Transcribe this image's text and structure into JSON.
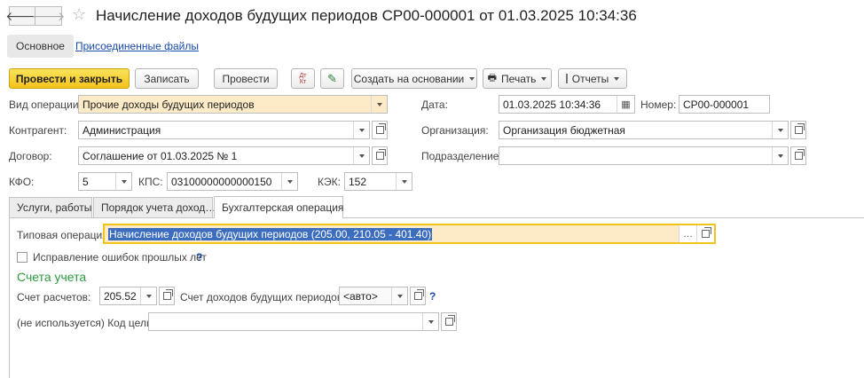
{
  "header": {
    "title": "Начисление доходов будущих периодов СР00-000001 от 01.03.2025 10:34:36",
    "back_icon": "arrow-left-icon",
    "forward_icon": "arrow-right-icon",
    "favorite_icon": "star-icon"
  },
  "top_tabs": {
    "main": "Основное",
    "attached": "Присоединенные файлы"
  },
  "toolbar": {
    "post_close": "Провести и закрыть",
    "save": "Записать",
    "post": "Провести",
    "dt_kt": "Дт\nКт",
    "create_based": "Создать на основании",
    "print": "Печать",
    "reports": "Отчеты"
  },
  "form": {
    "op_type_label": "Вид операции:",
    "op_type_value": "Прочие доходы будущих периодов",
    "date_label": "Дата:",
    "date_value": "01.03.2025 10:34:36",
    "number_label": "Номер:",
    "number_value": "СР00-000001",
    "counterparty_label": "Контрагент:",
    "counterparty_value": "Администрация",
    "organization_label": "Организация:",
    "organization_value": "Организация бюджетная",
    "contract_label": "Договор:",
    "contract_value": "Соглашение от 01.03.2025 № 1",
    "department_label": "Подразделение:",
    "department_value": "",
    "kfo_label": "КФО:",
    "kfo_value": "5",
    "kps_label": "КПС:",
    "kps_value": "03100000000000150",
    "kek_label": "КЭК:",
    "kek_value": "152"
  },
  "tabs": [
    {
      "label": "Услуги, работы"
    },
    {
      "label": "Порядок учета доход…"
    },
    {
      "label": "Бухгалтерская операция"
    }
  ],
  "accounting": {
    "typical_op_label": "Типовая операция:",
    "typical_op_value": "Начисление доходов будущих периодов (205.00, 210.05 - 401.40)",
    "fix_errors_label": "Исправление ошибок прошлых лет",
    "help": "?",
    "section_title": "Счета учета",
    "settle_account_label": "Счет расчетов:",
    "settle_account_value": "205.52",
    "future_income_label": "Счет доходов будущих периодов:",
    "future_income_placeholder": "<авто>",
    "target_code_label": "(не используется) Код цели:",
    "target_code_value": ""
  }
}
